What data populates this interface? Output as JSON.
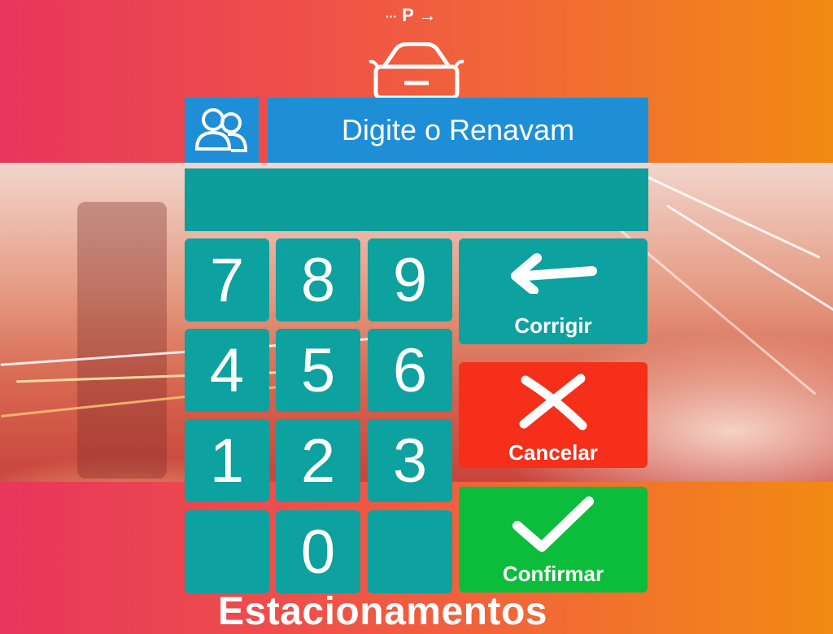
{
  "background": {
    "logo_letter": "P",
    "brand_text": "Estacionamentos",
    "gradient_colors": [
      "#e8365c",
      "#f28a12"
    ]
  },
  "dialog": {
    "header_icon": "users-icon",
    "title": "Digite o Renavam",
    "input_value": ""
  },
  "keypad": {
    "rows": [
      [
        "7",
        "8",
        "9"
      ],
      [
        "4",
        "5",
        "6"
      ],
      [
        "1",
        "2",
        "3"
      ],
      [
        "",
        "0",
        ""
      ]
    ]
  },
  "actions": {
    "correct": {
      "label": "Corrigir",
      "icon": "arrow-left-icon",
      "color": "#0da19f"
    },
    "cancel": {
      "label": "Cancelar",
      "icon": "close-icon",
      "color": "#f52f1a"
    },
    "confirm": {
      "label": "Confirmar",
      "icon": "checkmark-icon",
      "color": "#0cbd3c"
    }
  },
  "colors": {
    "header_blue": "#1e8fd6",
    "key_teal": "#0da19f"
  }
}
